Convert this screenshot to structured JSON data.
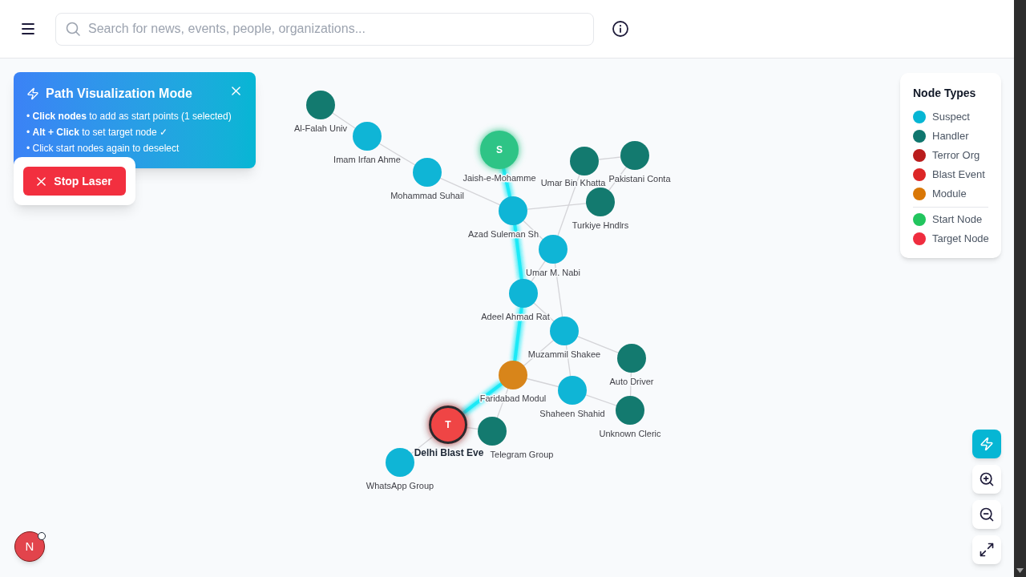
{
  "header": {
    "search": {
      "placeholder": "Search for news, events, people, organizations..."
    }
  },
  "path_panel": {
    "title": "Path Visualization Mode",
    "instructions": [
      "• **Click nodes** to add as start points (1 selected)",
      "• **Alt + Click** to set target node ✓",
      "• Click start nodes again to deselect"
    ]
  },
  "stop_button": {
    "label": "Stop Laser"
  },
  "graph": {
    "nodes": [
      {
        "label": "Al-Falah Univ",
        "kind": "handler"
      },
      {
        "label": "Imam Irfan Ahme",
        "kind": "suspect"
      },
      {
        "label": "Mohammad Suhail",
        "kind": "suspect"
      },
      {
        "label": "Jaish-e-Mohamme",
        "kind": "start",
        "badge": "S"
      },
      {
        "label": "Umar Bin Khatta",
        "kind": "handler"
      },
      {
        "label": "Pakistani Conta",
        "kind": "handler"
      },
      {
        "label": "Azad Suleman Sh",
        "kind": "suspect"
      },
      {
        "label": "Turkiye Hndlrs",
        "kind": "handler"
      },
      {
        "label": "Umar M. Nabi",
        "kind": "suspect"
      },
      {
        "label": "Adeel Ahmad Rat",
        "kind": "suspect"
      },
      {
        "label": "Muzammil Shakee",
        "kind": "suspect"
      },
      {
        "label": "Auto Driver",
        "kind": "handler"
      },
      {
        "label": "Faridabad Modul",
        "kind": "module"
      },
      {
        "label": "Shaheen Shahid",
        "kind": "suspect"
      },
      {
        "label": "Unknown Cleric",
        "kind": "handler"
      },
      {
        "label": "Delhi Blast Eve",
        "kind": "target",
        "badge": "T"
      },
      {
        "label": "Telegram Group",
        "kind": "handler"
      },
      {
        "label": "WhatsApp Group",
        "kind": "suspect"
      }
    ],
    "edges": [
      {
        "on_path": false
      },
      {
        "on_path": false
      },
      {
        "on_path": true
      },
      {
        "on_path": false
      },
      {
        "on_path": false
      },
      {
        "on_path": false
      },
      {
        "on_path": false
      },
      {
        "on_path": false
      },
      {
        "on_path": false
      },
      {
        "on_path": true
      },
      {
        "on_path": false
      },
      {
        "on_path": false
      },
      {
        "on_path": false
      },
      {
        "on_path": true
      },
      {
        "on_path": false
      },
      {
        "on_path": false
      },
      {
        "on_path": false
      },
      {
        "on_path": false
      },
      {
        "on_path": false
      },
      {
        "on_path": true
      },
      {
        "on_path": false
      },
      {
        "on_path": false
      },
      {
        "on_path": false
      },
      {
        "on_path": false
      }
    ]
  },
  "legend": {
    "title": "Node Types",
    "sections": [
      {
        "items": [
          {
            "label": "Suspect",
            "color": "#06b6d4"
          },
          {
            "label": "Handler",
            "color": "#0f766e"
          },
          {
            "label": "Terror Org",
            "color": "#b91c1c"
          },
          {
            "label": "Blast Event",
            "color": "#dc2626"
          },
          {
            "label": "Module",
            "color": "#d97706"
          }
        ]
      },
      {
        "items": [
          {
            "label": "Start Node",
            "color": "#22c55e"
          },
          {
            "label": "Target Node",
            "color": "#ef2d3f"
          }
        ]
      }
    ]
  },
  "controls": {
    "laser_toggle": {
      "on": true
    }
  },
  "avatar": {
    "initial": "N"
  }
}
